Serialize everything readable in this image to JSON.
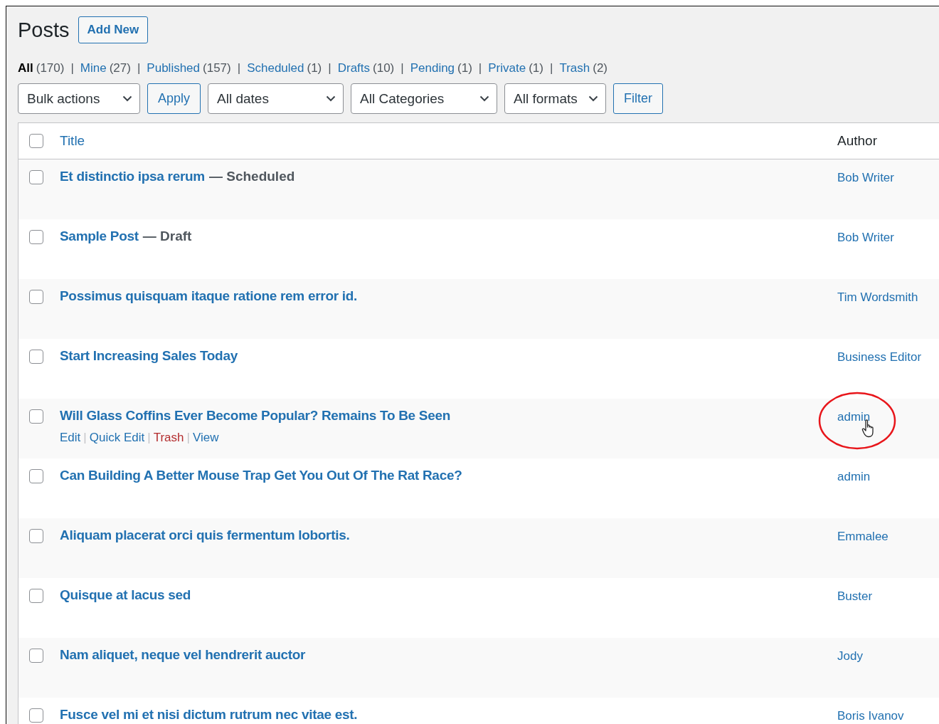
{
  "header": {
    "title": "Posts",
    "add_button": "Add New"
  },
  "filters": [
    {
      "label": "All",
      "count": "(170)",
      "selected": true
    },
    {
      "label": "Mine",
      "count": "(27)",
      "selected": false
    },
    {
      "label": "Published",
      "count": "(157)",
      "selected": false
    },
    {
      "label": "Scheduled",
      "count": "(1)",
      "selected": false
    },
    {
      "label": "Drafts",
      "count": "(10)",
      "selected": false
    },
    {
      "label": "Pending",
      "count": "(1)",
      "selected": false
    },
    {
      "label": "Private",
      "count": "(1)",
      "selected": false
    },
    {
      "label": "Trash",
      "count": "(2)",
      "selected": false
    }
  ],
  "separator": "|",
  "toolbar": [
    {
      "kind": "select",
      "label": "Bulk actions"
    },
    {
      "kind": "button",
      "label": "Apply"
    },
    {
      "kind": "select",
      "label": "All dates"
    },
    {
      "kind": "select",
      "label": "All Categories"
    },
    {
      "kind": "select",
      "label": "All formats"
    },
    {
      "kind": "button",
      "label": "Filter"
    }
  ],
  "table": {
    "columns": [
      "Title",
      "Author"
    ],
    "select_all_checked": false,
    "rows": [
      {
        "title": "Et distinctio ipsa rerum",
        "state": "— Scheduled",
        "author": "Bob Writer",
        "checked": false,
        "circled": false
      },
      {
        "title": "Sample Post",
        "state": "— Draft",
        "author": "Bob Writer",
        "checked": false,
        "circled": false
      },
      {
        "title": "Possimus quisquam itaque ratione rem error id.",
        "author": "Tim Wordsmith",
        "checked": false,
        "circled": false
      },
      {
        "title": "Start Increasing Sales Today",
        "author": "Business Editor",
        "checked": false,
        "circled": false
      },
      {
        "title": "Will Glass Coffins Ever Become Popular? Remains To Be Seen",
        "author": "admin",
        "checked": false,
        "circled": true,
        "actions": [
          {
            "label": "Edit",
            "kind": "link"
          },
          {
            "label": "Quick Edit",
            "kind": "link"
          },
          {
            "label": "Trash",
            "kind": "delete"
          },
          {
            "label": "View",
            "kind": "link"
          }
        ]
      },
      {
        "title": "Can Building A Better Mouse Trap Get You Out Of The Rat Race?",
        "author": "admin",
        "checked": false,
        "circled": false
      },
      {
        "title": "Aliquam placerat orci quis fermentum lobortis.",
        "author": "Emmalee",
        "checked": false,
        "circled": false
      },
      {
        "title": "Quisque at lacus sed",
        "author": "Buster",
        "checked": false,
        "circled": false
      },
      {
        "title": "Nam aliquet, neque vel hendrerit auctor",
        "author": "Jody",
        "checked": false,
        "circled": false
      },
      {
        "title": "Fusce vel mi et nisi dictum rutrum nec vitae est.",
        "author": "Boris Ivanov",
        "checked": false,
        "circled": false
      }
    ]
  }
}
